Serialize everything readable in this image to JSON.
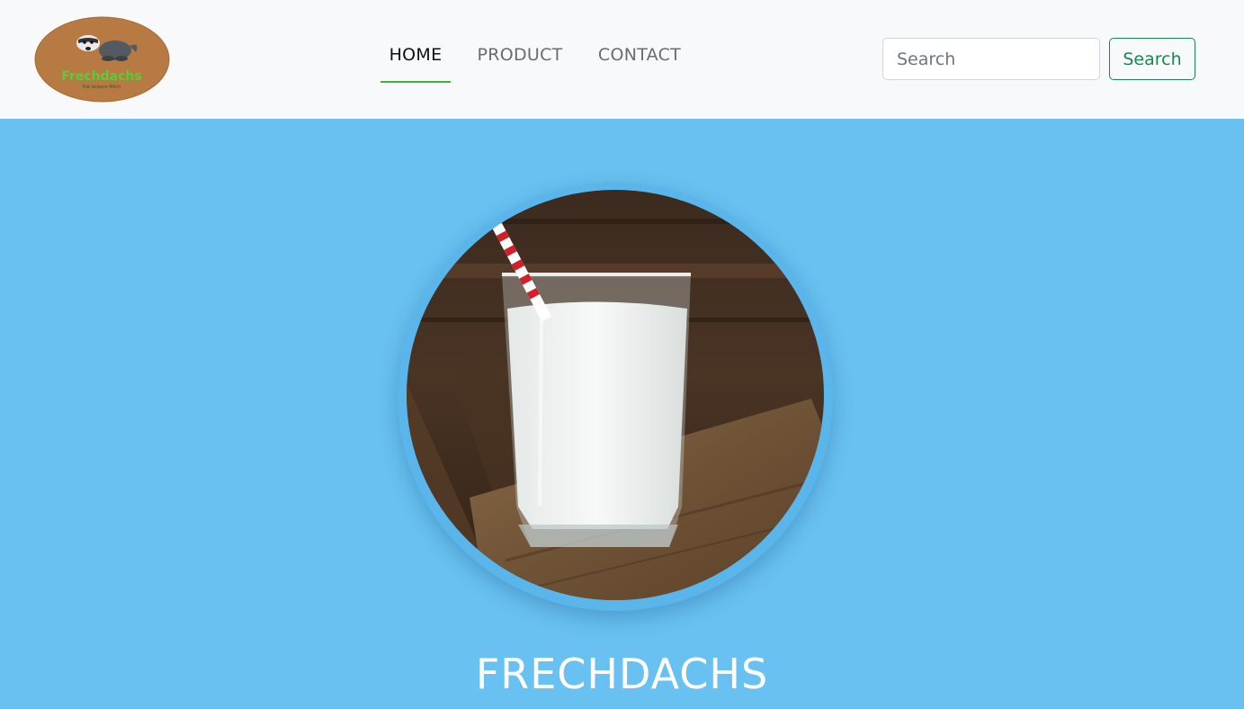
{
  "brand": {
    "logo_text": "Frechdachs",
    "logo_subtext": "Die leckere Milch",
    "colors": {
      "logo_bg": "#b87a43",
      "logo_text": "#5fc93a"
    }
  },
  "nav": {
    "items": [
      {
        "label": "HOME",
        "active": true
      },
      {
        "label": "PRODUCT",
        "active": false
      },
      {
        "label": "CONTACT",
        "active": false
      }
    ]
  },
  "search": {
    "placeholder": "Search",
    "button_label": "Search"
  },
  "hero": {
    "image_subject": "glass-of-milk-with-striped-straw",
    "title": "FRECHDACHS"
  },
  "colors": {
    "hero_bg": "#68c1f0",
    "navbar_bg": "#f8f9fa",
    "active_underline": "#3db53d",
    "search_button": "#198754"
  }
}
